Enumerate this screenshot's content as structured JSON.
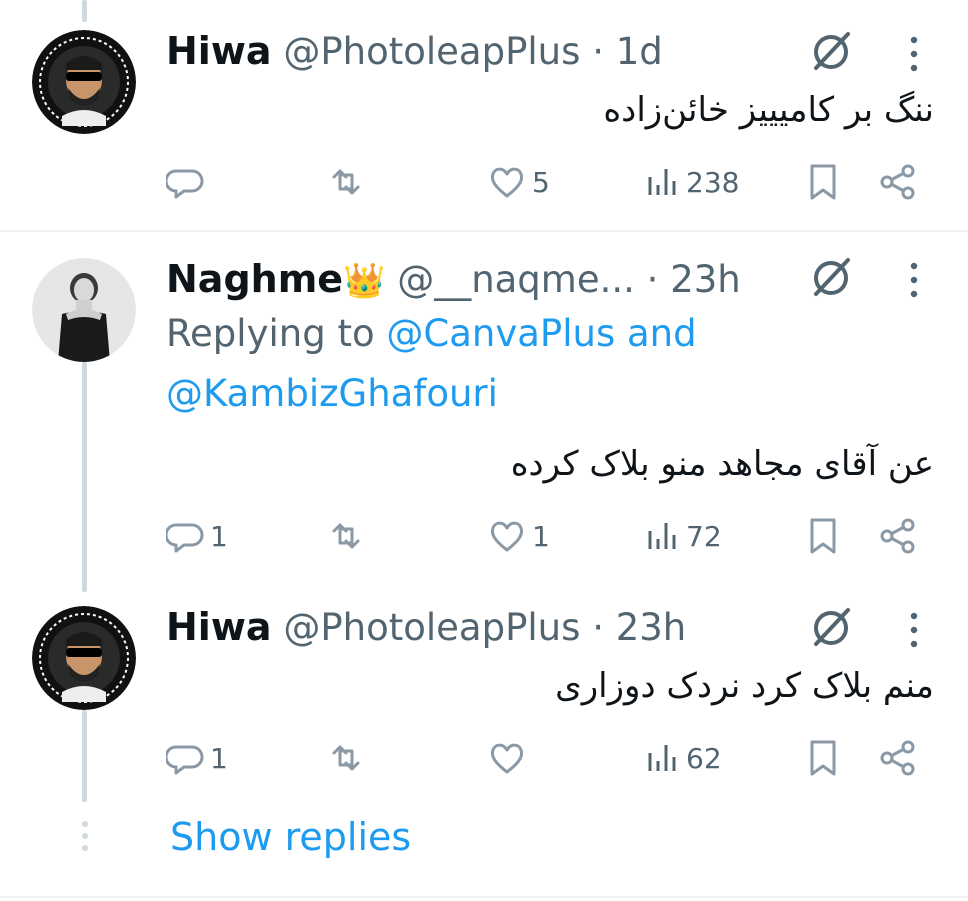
{
  "tweets": [
    {
      "name": "Hiwa",
      "handle": "@PhotoleapPlus",
      "separator": "·",
      "time": "1d",
      "text": "ننگ بر کامیییز خائن‌زاده",
      "reply_count": "",
      "like_count": "5",
      "view_count": "238"
    },
    {
      "name": "Naghme",
      "name_emoji": "👑",
      "handle": "@__naqme...",
      "separator": "·",
      "time": "23h",
      "replying_to_prefix": "Replying to",
      "mention1": "@CanvaPlus",
      "and_word": "and",
      "mention2": "@KambizGhafouri",
      "text": "عن آقای مجاهد منو بلاک کرده",
      "reply_count": "1",
      "like_count": "1",
      "view_count": "72"
    },
    {
      "name": "Hiwa",
      "handle": "@PhotoleapPlus",
      "separator": "·",
      "time": "23h",
      "text": "منم بلاک کرد نردک دوزاری",
      "reply_count": "1",
      "like_count": "",
      "view_count": "62"
    }
  ],
  "show_replies": "Show replies",
  "colors": {
    "link": "#1d9bf0",
    "text": "#0f1419",
    "muted": "#536471",
    "thread_line": "#cfd9de"
  },
  "icons": [
    "reply-icon",
    "retweet-icon",
    "like-icon",
    "views-icon",
    "bookmark-icon",
    "share-icon",
    "grok-icon",
    "more-icon"
  ]
}
